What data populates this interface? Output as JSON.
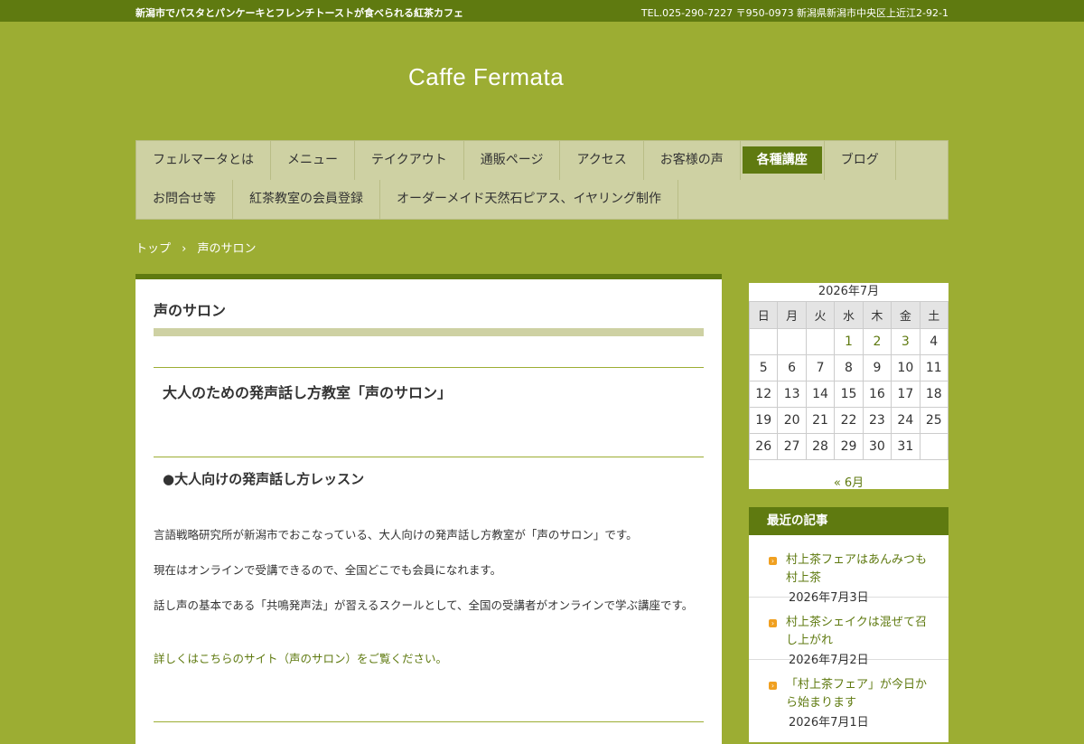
{
  "topbar": {
    "tagline": "新潟市でパスタとパンケーキとフレンチトーストが食べられる紅茶カフェ",
    "contact": "TEL.025-290-7227 〒950-0973 新潟県新潟市中央区上近江2-92-1"
  },
  "site": {
    "title": "Caffe Fermata"
  },
  "nav": {
    "row1": [
      "フェルマータとは",
      "メニュー",
      "テイクアウト",
      "通販ページ",
      "アクセス",
      "お客様の声",
      "各種講座",
      "ブログ"
    ],
    "row2": [
      "お問合せ等",
      "紅茶教室の会員登録",
      "オーダーメイド天然石ピアス、イヤリング制作"
    ],
    "active": "各種講座"
  },
  "breadcrumb": {
    "home": "トップ",
    "sep": "›",
    "current": "声のサロン"
  },
  "main": {
    "page_title": "声のサロン",
    "heading": "大人のための発声話し方教室「声のサロン」",
    "subheading": "●大人向けの発声話し方レッスン",
    "para1": "言語戦略研究所が新潟市でおこなっている、大人向けの発声話し方教室が「声のサロン」です。",
    "para2": "現在はオンラインで受講できるので、全国どこでも会員になれます。",
    "para3": "話し声の基本である「共鳴発声法」が習えるスクールとして、全国の受講者がオンラインで学ぶ講座です。",
    "link": "詳しくはこちらのサイト（声のサロン）をご覧ください。"
  },
  "calendar": {
    "caption": "2026年7月",
    "weekdays": [
      "日",
      "月",
      "火",
      "水",
      "木",
      "金",
      "土"
    ],
    "weeks": [
      [
        "",
        "",
        "",
        "1",
        "2",
        "3",
        "4"
      ],
      [
        "5",
        "6",
        "7",
        "8",
        "9",
        "10",
        "11"
      ],
      [
        "12",
        "13",
        "14",
        "15",
        "16",
        "17",
        "18"
      ],
      [
        "19",
        "20",
        "21",
        "22",
        "23",
        "24",
        "25"
      ],
      [
        "26",
        "27",
        "28",
        "29",
        "30",
        "31",
        ""
      ]
    ],
    "linked_days": [
      "1",
      "2",
      "3"
    ],
    "prev": "« 6月"
  },
  "recent": {
    "heading": "最近の記事",
    "posts": [
      {
        "title": "村上茶フェアはあんみつも村上茶",
        "date": "2026年7月3日"
      },
      {
        "title": "村上茶シェイクは混ぜて召し上がれ",
        "date": "2026年7月2日"
      },
      {
        "title": "「村上茶フェア」が今日から始まります",
        "date": "2026年7月1日"
      }
    ]
  },
  "colors": {
    "accent": "#5f7a10",
    "background": "#9cad33",
    "nav": "#ced1a3",
    "bullet": "#f0a020"
  }
}
